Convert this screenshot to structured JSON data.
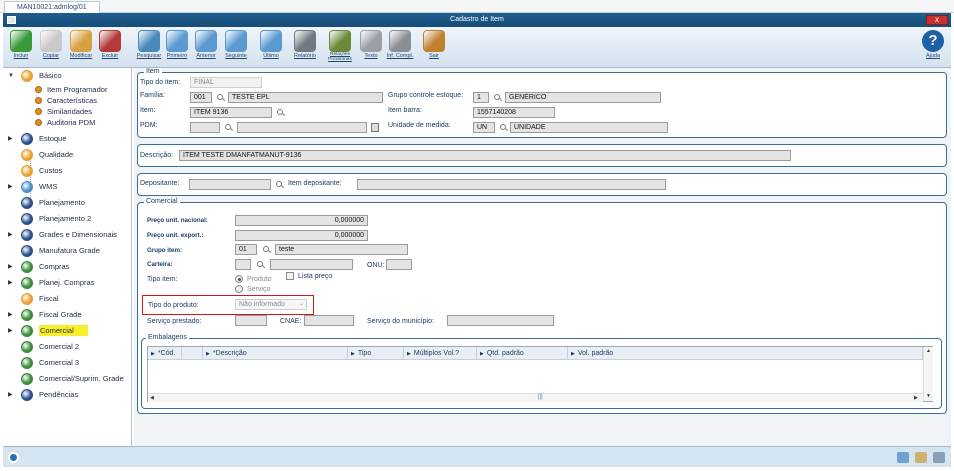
{
  "tab_label": "MAN10021:admlog/01",
  "window_title": "Cadastro de Item",
  "close_label": "x",
  "toolbar": [
    {
      "label": "Incluir",
      "icon": "add-icon",
      "color": "#3a9a3a"
    },
    {
      "label": "Copiar",
      "icon": "copy-icon",
      "color": "#c9c9c9"
    },
    {
      "label": "Modificar",
      "icon": "edit-icon",
      "color": "#d8a040"
    },
    {
      "label": "Excluir",
      "icon": "delete-icon",
      "color": "#b53a3a"
    },
    {
      "label": "Pesquisar",
      "icon": "search-icon",
      "color": "#4a8abb"
    },
    {
      "label": "Primeiro",
      "icon": "first-icon",
      "color": "#5a9ad0"
    },
    {
      "label": "Anterior",
      "icon": "previous-icon",
      "color": "#5a9ad0"
    },
    {
      "label": "Seguinte",
      "icon": "next-icon",
      "color": "#5a9ad0"
    },
    {
      "label": "Último",
      "icon": "last-icon",
      "color": "#5a9ad0"
    },
    {
      "label": "Relatório",
      "icon": "report-icon",
      "color": "#707a80"
    },
    {
      "label": "Relações Provisórias",
      "icon": "relations-icon",
      "color": "#6a8a3a"
    },
    {
      "label": "Texto",
      "icon": "text-icon",
      "color": "#9aa0a6"
    },
    {
      "label": "Inf. Compl.",
      "icon": "info-complement-icon",
      "color": "#8a8f95"
    },
    {
      "label": "Sair",
      "icon": "exit-icon",
      "color": "#c08030"
    }
  ],
  "help_label": "Ajuda",
  "sidebar": {
    "items": [
      {
        "label": "Básico",
        "color": "#e8a030",
        "expanded": true
      },
      {
        "label": "Estoque",
        "color": "#2b4f8a"
      },
      {
        "label": "Qualidade",
        "color": "#e8a030"
      },
      {
        "label": "Custos",
        "color": "#e8a030"
      },
      {
        "label": "WMS",
        "color": "#4a90c8"
      },
      {
        "label": "Planejamento",
        "color": "#2b4f8a"
      },
      {
        "label": "Planejamento 2",
        "color": "#2b4f8a"
      },
      {
        "label": "Grades e Dimensionais",
        "color": "#2b4f8a"
      },
      {
        "label": "Manufatura Grade",
        "color": "#2b4f8a"
      },
      {
        "label": "Compras",
        "color": "#3a8a3a"
      },
      {
        "label": "Planej. Compras",
        "color": "#3a8a3a"
      },
      {
        "label": "Fiscal",
        "color": "#e8a030"
      },
      {
        "label": "Fiscal Grade",
        "color": "#3a8a3a"
      },
      {
        "label": "Comercial",
        "color": "#3a8a3a",
        "selected": true
      },
      {
        "label": "Comercial 2",
        "color": "#3a8a3a"
      },
      {
        "label": "Comercial 3",
        "color": "#3a8a3a"
      },
      {
        "label": "Comercial/Suprim. Grade",
        "color": "#3a8a3a"
      },
      {
        "label": "Pendências",
        "color": "#2b4f8a"
      }
    ],
    "subitems": [
      "Item Programador",
      "Características",
      "Similaridades",
      "Auditoria PDM"
    ]
  },
  "item": {
    "group_title": "Item",
    "tipo_label": "Tipo do item:",
    "tipo_value": "FINAL",
    "familia_label": "Família:",
    "familia_code": "001",
    "familia_desc": "TESTE EPL",
    "grupo_label": "Grupo controle estoque:",
    "grupo_code": "1",
    "grupo_desc": "GENÉRICO",
    "item_label": "Item:",
    "item_value": "ITEM 9136",
    "barra_label": "Item barra:",
    "barra_value": "1557140208",
    "pdm_label": "PDM:",
    "unidade_label": "Unidade de medida:",
    "unidade_code": "UN",
    "unidade_desc": "UNIDADE"
  },
  "descricao": {
    "label": "Descrição:",
    "value": "ITEM TESTE DMANFATMANUT-9136"
  },
  "depositante": {
    "label": "Depositante:",
    "item_label": "Item depositante:"
  },
  "comercial": {
    "group_title": "Comercial",
    "preco_nacional_label": "Preço unit. nacional:",
    "preco_nacional_value": "0,000000",
    "preco_export_label": "Preço unit. export.:",
    "preco_export_value": "0,000000",
    "grupo_item_label": "Grupo item:",
    "grupo_item_code": "01",
    "grupo_item_desc": "teste",
    "carteira_label": "Carteira:",
    "onu_label": "ONU:",
    "tipo_item_label": "Tipo item:",
    "lista_preco_label": "Lista preço",
    "radio_produto": "Produto",
    "radio_servico": "Serviço",
    "tipo_produto_label": "Tipo do produto:",
    "tipo_produto_value": "Não informado",
    "servico_prestado_label": "Serviço prestado:",
    "cnae_label": "CNAE:",
    "servico_municipio_label": "Serviço do município:"
  },
  "embalagens": {
    "group_title": "Embalagens",
    "columns": [
      "*Cód.",
      "*Descrição",
      "Tipo",
      "Múltiplos Vol.?",
      "Qtd. padrão",
      "Vol. padrão"
    ]
  }
}
